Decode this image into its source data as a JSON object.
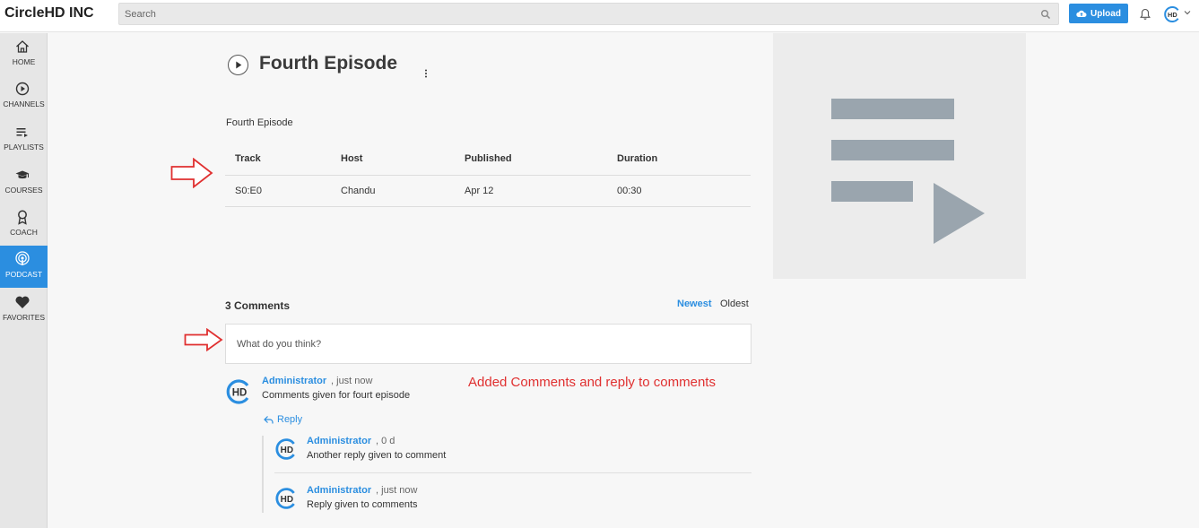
{
  "header": {
    "brand": "CircleHD INC",
    "search_placeholder": "Search",
    "upload_label": "Upload",
    "avatar_text": "HD"
  },
  "sidebar": {
    "items": [
      {
        "label": "HOME",
        "icon": "home-icon"
      },
      {
        "label": "CHANNELS",
        "icon": "play-circle-icon"
      },
      {
        "label": "PLAYLISTS",
        "icon": "playlist-icon"
      },
      {
        "label": "COURSES",
        "icon": "graduation-cap-icon"
      },
      {
        "label": "COACH",
        "icon": "coach-icon"
      },
      {
        "label": "PODCAST",
        "icon": "podcast-icon",
        "active": true
      },
      {
        "label": "FAVORITES",
        "icon": "heart-icon"
      }
    ]
  },
  "episode": {
    "title": "Fourth Episode",
    "description": "Fourth Episode"
  },
  "tracks": {
    "headers": [
      "Track",
      "Host",
      "Published",
      "Duration"
    ],
    "rows": [
      [
        "S0:E0",
        "Chandu",
        "Apr 12",
        "00:30"
      ]
    ]
  },
  "comments": {
    "count_label": "3 Comments",
    "sort_newest": "Newest",
    "sort_oldest": "Oldest",
    "input_placeholder": "What do you think?",
    "reply_label": "Reply",
    "items": [
      {
        "author": "Administrator",
        "time": "just now",
        "text": "Comments given for fourt episode"
      }
    ],
    "replies": [
      {
        "author": "Administrator",
        "time": "0 d",
        "text": "Another reply given to comment"
      },
      {
        "author": "Administrator",
        "time": "just now",
        "text": "Reply given to comments"
      }
    ]
  },
  "annotation": "Added Comments and reply to comments",
  "colors": {
    "accent": "#2b8ee0",
    "annotation": "#e03030",
    "sidebar_bg": "#e6e6e6"
  }
}
